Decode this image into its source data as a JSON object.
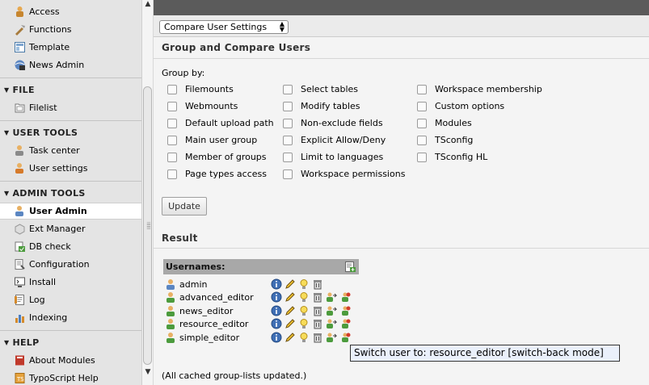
{
  "sidebar": {
    "items_top": [
      {
        "label": "Access",
        "icon": "access-icon"
      },
      {
        "label": "Functions",
        "icon": "functions-icon"
      },
      {
        "label": "Template",
        "icon": "template-icon"
      },
      {
        "label": "News Admin",
        "icon": "news-admin-icon"
      }
    ],
    "sections": [
      {
        "title": "FILE",
        "items": [
          {
            "label": "Filelist",
            "icon": "filelist-icon"
          }
        ]
      },
      {
        "title": "USER TOOLS",
        "items": [
          {
            "label": "Task center",
            "icon": "task-center-icon"
          },
          {
            "label": "User settings",
            "icon": "user-settings-icon"
          }
        ]
      },
      {
        "title": "ADMIN TOOLS",
        "items": [
          {
            "label": "User Admin",
            "icon": "user-admin-icon",
            "active": true
          },
          {
            "label": "Ext Manager",
            "icon": "ext-manager-icon"
          },
          {
            "label": "DB check",
            "icon": "db-check-icon"
          },
          {
            "label": "Configuration",
            "icon": "configuration-icon"
          },
          {
            "label": "Install",
            "icon": "install-icon"
          },
          {
            "label": "Log",
            "icon": "log-icon"
          },
          {
            "label": "Indexing",
            "icon": "indexing-icon"
          }
        ]
      },
      {
        "title": "HELP",
        "items": [
          {
            "label": "About Modules",
            "icon": "about-modules-icon"
          },
          {
            "label": "TypoScript Help",
            "icon": "typoscript-help-icon"
          }
        ]
      }
    ]
  },
  "toolbar": {
    "function_select": "Compare User Settings"
  },
  "main": {
    "section_title": "Group and Compare Users",
    "group_by_label": "Group by:",
    "checkbox_columns": [
      [
        "Filemounts",
        "Webmounts",
        "Default upload path",
        "Main user group",
        "Member of groups",
        "Page types access"
      ],
      [
        "Select tables",
        "Modify tables",
        "Non-exclude fields",
        "Explicit Allow/Deny",
        "Limit to languages",
        "Workspace permissions"
      ],
      [
        "Workspace membership",
        "Custom options",
        "Modules",
        "TSconfig",
        "TSconfig HL"
      ]
    ],
    "update_label": "Update",
    "result_title": "Result",
    "usernames_header": "Usernames:",
    "users": [
      {
        "name": "admin",
        "admin": true
      },
      {
        "name": "advanced_editor",
        "admin": false
      },
      {
        "name": "news_editor",
        "admin": false
      },
      {
        "name": "resource_editor",
        "admin": false
      },
      {
        "name": "simple_editor",
        "admin": false
      }
    ],
    "tooltip": "Switch user to: resource_editor [switch-back mode]",
    "cache_message": "(All cached group-lists updated.)"
  },
  "colors": {
    "sidebar_bg": "#e4e4e4",
    "topbar": "#5b5b5b",
    "header_bar": "#a8a8a8",
    "tooltip_bg": "#eaf0fb"
  }
}
